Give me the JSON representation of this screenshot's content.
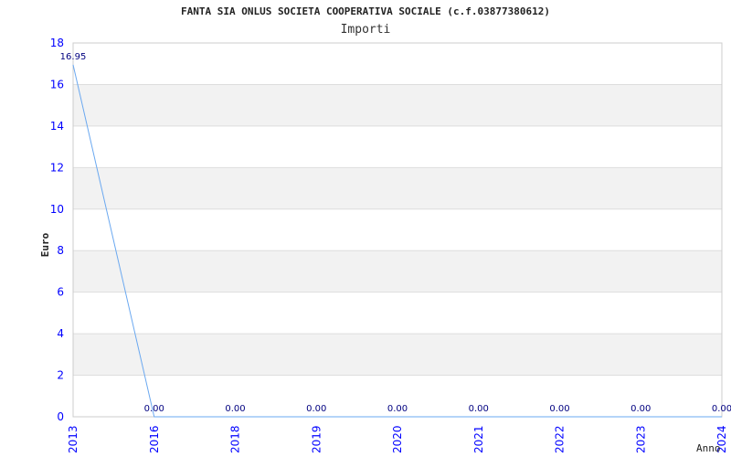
{
  "chart_data": {
    "type": "line",
    "title": "FANTA SIA ONLUS SOCIETA COOPERATIVA SOCIALE (c.f.03877380612)",
    "subtitle": "Importi",
    "xlabel": "Anno",
    "ylabel": "Euro",
    "categories": [
      "2013",
      "2016",
      "2018",
      "2019",
      "2020",
      "2021",
      "2022",
      "2023",
      "2024"
    ],
    "values": [
      16.95,
      0,
      0,
      0,
      0,
      0,
      0,
      0,
      0
    ],
    "data_labels": [
      "16.95",
      "0.00",
      "0.00",
      "0.00",
      "0.00",
      "0.00",
      "0.00",
      "0.00",
      "0.00"
    ],
    "ylim": [
      0,
      18
    ],
    "yticks": [
      "0",
      "2",
      "4",
      "6",
      "8",
      "10",
      "12",
      "14",
      "16",
      "18"
    ],
    "grid": true,
    "colors": {
      "line": "#6aa8f0",
      "ticks": "#0000ff",
      "labels": "#000080",
      "band": "#f2f2f2"
    }
  }
}
